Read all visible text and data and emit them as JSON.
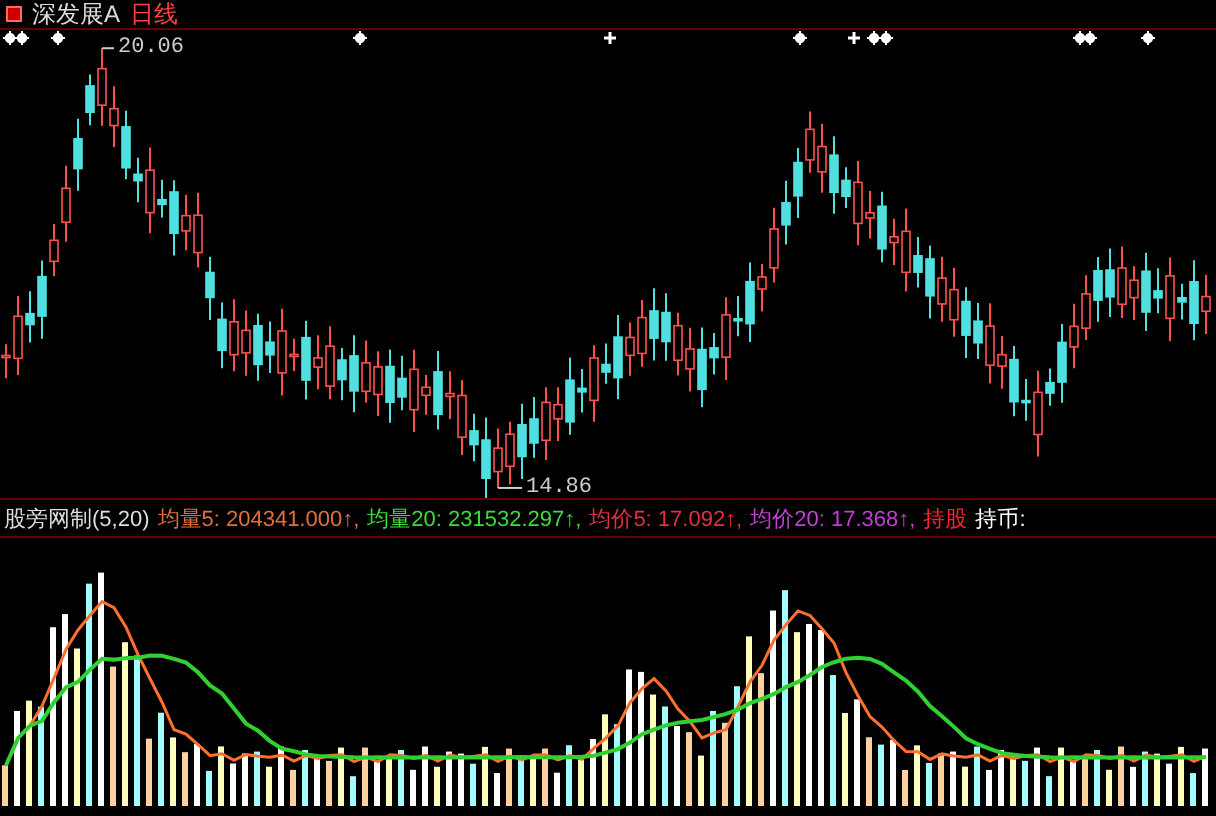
{
  "title_bar": {
    "stock": "深发展A",
    "period": "日线"
  },
  "price_chart": {
    "high_label": "20.06",
    "low_label": "14.86"
  },
  "indicator_bar": {
    "name": "股旁网制(5,20)",
    "items": [
      {
        "text": "均量5: 204341.000↑,",
        "color": "#e0703a"
      },
      {
        "text": "均量20: 231532.297↑,",
        "color": "#3cdc3c"
      },
      {
        "text": "均价5: 17.092↑,",
        "color": "#e03040"
      },
      {
        "text": "均价20: 17.368↑,",
        "color": "#c040d0"
      },
      {
        "text": "持股",
        "color": "#ff2030"
      },
      {
        "text": "持币:",
        "color": "#ffffff"
      }
    ]
  }
}
